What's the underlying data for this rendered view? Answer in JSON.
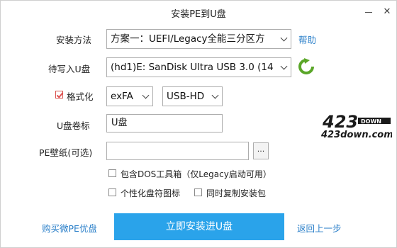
{
  "window": {
    "title": "安装PE到U盘",
    "minimize_glyph": "—",
    "close_glyph": "✕"
  },
  "form": {
    "method_label": "安装方法",
    "method_value": "方案一：UEFI/Legacy全能三分区方",
    "help_link": "帮助",
    "target_label": "待写入U盘",
    "target_value": "(hd1)E: SanDisk Ultra USB 3.0 (14",
    "format_label": "格式化",
    "format_checked": true,
    "filesystem_value": "exFA",
    "mode_value": "USB-HD",
    "volume_label": "U盘卷标",
    "volume_value": "U盘",
    "wallpaper_label": "PE壁纸(可选)",
    "wallpaper_value": "",
    "browse_label": "...",
    "opt_dos": "包含DOS工具箱（仅Legacy启动可用）",
    "opt_icon": "个性化盘符图标",
    "opt_copy": "同时复制安装包"
  },
  "footer": {
    "buy_link": "购买微PE优盘",
    "install_button": "立即安装进U盘",
    "back_link": "返回上一步"
  },
  "logo": {
    "big": "423",
    "small": "DOWN",
    "url": "423down.com"
  },
  "colors": {
    "accent": "#2aa3ea",
    "link": "#2a7fc9",
    "refresh_green": "#5aa628"
  }
}
